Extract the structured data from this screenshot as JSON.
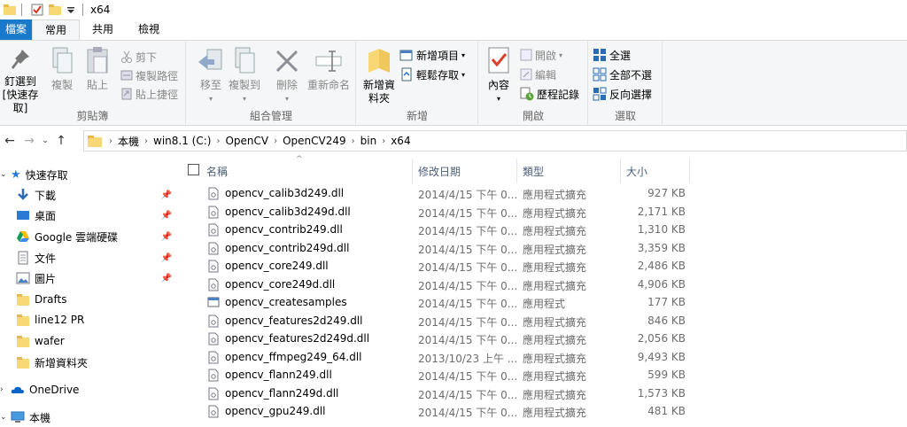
{
  "window": {
    "title": "x64"
  },
  "tabs": {
    "file": "檔案",
    "home": "常用",
    "share": "共用",
    "view": "檢視"
  },
  "ribbon": {
    "clipboard": {
      "label": "剪貼簿",
      "pin": "釘選到 [快速存取]",
      "copy": "複製",
      "paste": "貼上",
      "cut": "剪下",
      "copy_path": "複製路徑",
      "paste_shortcut": "貼上捷徑"
    },
    "organize": {
      "label": "組合管理",
      "move_to": "移至",
      "copy_to": "複製到",
      "delete": "刪除",
      "rename": "重新命名"
    },
    "new": {
      "label": "新增",
      "new_folder": "新增資料夾",
      "new_item": "新增項目",
      "easy_access": "輕鬆存取"
    },
    "open": {
      "label": "開啟",
      "properties": "內容",
      "open": "開啟",
      "edit": "編輯",
      "history": "歷程記錄"
    },
    "select": {
      "label": "選取",
      "select_all": "全選",
      "select_none": "全部不選",
      "invert": "反向選擇"
    }
  },
  "address": {
    "crumbs": [
      "本機",
      "win8.1 (C:)",
      "OpenCV",
      "OpenCV249",
      "bin",
      "x64"
    ]
  },
  "nav": {
    "quick_access": "快速存取",
    "items": [
      {
        "label": "下載",
        "pinned": "📌"
      },
      {
        "label": "桌面",
        "pinned": "📌"
      },
      {
        "label": "Google 雲端硬碟",
        "pinned": "📌"
      },
      {
        "label": "文件",
        "pinned": "📌"
      },
      {
        "label": "圖片",
        "pinned": "📌"
      },
      {
        "label": "Drafts"
      },
      {
        "label": "line12 PR"
      },
      {
        "label": "wafer"
      },
      {
        "label": "新增資料夾"
      }
    ],
    "onedrive": "OneDrive",
    "this_pc": "本機"
  },
  "columns": {
    "name": "名稱",
    "date": "修改日期",
    "type": "類型",
    "size": "大小"
  },
  "files": [
    {
      "name": "opencv_calib3d249.dll",
      "date": "2014/4/15 下午 0...",
      "type": "應用程式擴充",
      "size": "927 KB"
    },
    {
      "name": "opencv_calib3d249d.dll",
      "date": "2014/4/15 下午 0...",
      "type": "應用程式擴充",
      "size": "2,171 KB"
    },
    {
      "name": "opencv_contrib249.dll",
      "date": "2014/4/15 下午 0...",
      "type": "應用程式擴充",
      "size": "1,310 KB"
    },
    {
      "name": "opencv_contrib249d.dll",
      "date": "2014/4/15 下午 0...",
      "type": "應用程式擴充",
      "size": "3,359 KB"
    },
    {
      "name": "opencv_core249.dll",
      "date": "2014/4/15 下午 0...",
      "type": "應用程式擴充",
      "size": "2,486 KB"
    },
    {
      "name": "opencv_core249d.dll",
      "date": "2014/4/15 下午 0...",
      "type": "應用程式擴充",
      "size": "4,906 KB"
    },
    {
      "name": "opencv_createsamples",
      "date": "2014/4/15 下午 0...",
      "type": "應用程式",
      "size": "177 KB"
    },
    {
      "name": "opencv_features2d249.dll",
      "date": "2014/4/15 下午 0...",
      "type": "應用程式擴充",
      "size": "846 KB"
    },
    {
      "name": "opencv_features2d249d.dll",
      "date": "2014/4/15 下午 0...",
      "type": "應用程式擴充",
      "size": "2,056 KB"
    },
    {
      "name": "opencv_ffmpeg249_64.dll",
      "date": "2013/10/23 上午 ...",
      "type": "應用程式擴充",
      "size": "9,493 KB"
    },
    {
      "name": "opencv_flann249.dll",
      "date": "2014/4/15 下午 0...",
      "type": "應用程式擴充",
      "size": "599 KB"
    },
    {
      "name": "opencv_flann249d.dll",
      "date": "2014/4/15 下午 0...",
      "type": "應用程式擴充",
      "size": "1,573 KB"
    },
    {
      "name": "opencv_gpu249.dll",
      "date": "2014/4/15 下午 0...",
      "type": "應用程式擴充",
      "size": "481 KB"
    }
  ],
  "colors": {
    "accent": "#1979ca",
    "folder": "#f8d775",
    "ribbon_bg": "#f5f6f7"
  }
}
